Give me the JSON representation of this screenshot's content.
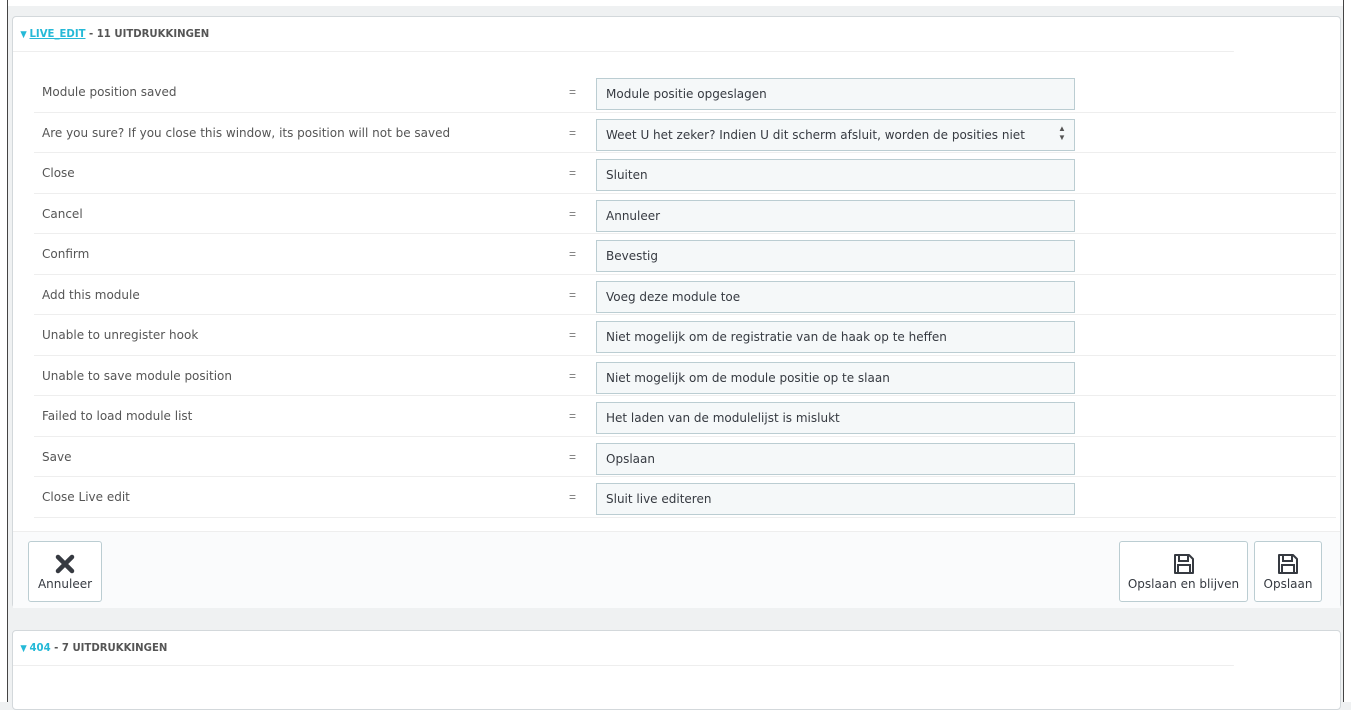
{
  "panel1": {
    "heading_name": "LIVE_EDIT",
    "heading_sep": " - ",
    "heading_count": "11 UITDRUKKINGEN",
    "rows": [
      {
        "source": "Module position saved",
        "eq": "=",
        "value": "Module positie opgeslagen"
      },
      {
        "source": "Are you sure? If you close this window, its position will not be saved",
        "eq": "=",
        "value": "Weet U het zeker? Indien U dit scherm afsluit, worden de posities niet"
      },
      {
        "source": "Close",
        "eq": "=",
        "value": "Sluiten"
      },
      {
        "source": "Cancel",
        "eq": "=",
        "value": "Annuleer"
      },
      {
        "source": "Confirm",
        "eq": "=",
        "value": "Bevestig"
      },
      {
        "source": "Add this module",
        "eq": "=",
        "value": "Voeg deze module toe"
      },
      {
        "source": "Unable to unregister hook",
        "eq": "=",
        "value": "Niet mogelijk om de registratie van de haak op te heffen"
      },
      {
        "source": "Unable to save module position",
        "eq": "=",
        "value": "Niet mogelijk om de module positie op te slaan"
      },
      {
        "source": "Failed to load module list",
        "eq": "=",
        "value": "Het laden van de modulelijst is mislukt"
      },
      {
        "source": "Save",
        "eq": "=",
        "value": "Opslaan"
      },
      {
        "source": "Close Live edit",
        "eq": "=",
        "value": "Sluit live editeren"
      }
    ],
    "footer": {
      "cancel_label": "Annuleer",
      "save_stay_label": "Opslaan en blijven",
      "save_label": "Opslaan"
    }
  },
  "panel2": {
    "heading_name": "404",
    "heading_sep": " - ",
    "heading_count": "7 UITDRUKKINGEN"
  },
  "colors": {
    "accent": "#25b9d7",
    "field_bg": "#f5f8f9",
    "field_border": "#bbcdd2"
  }
}
